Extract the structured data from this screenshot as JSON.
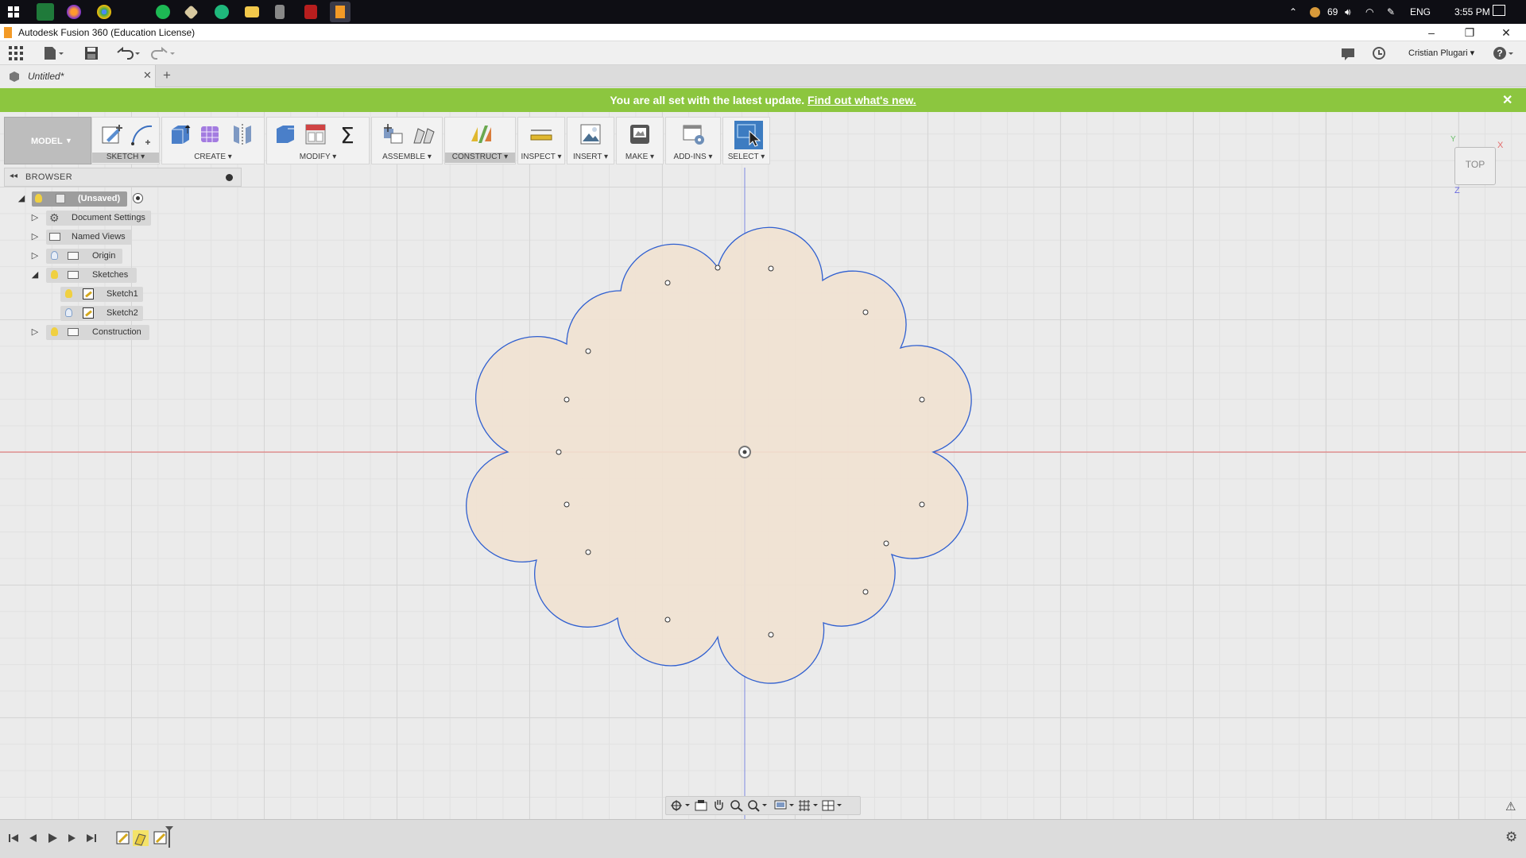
{
  "taskbar": {
    "apps": [
      "start-icon",
      "spreadsheet-icon",
      "firefox-icon",
      "chrome-icon",
      "spotify-icon",
      "git-icon",
      "arrow-app-icon",
      "file-explorer-icon",
      "calculator-icon",
      "pdf-icon",
      "fusion360-icon"
    ],
    "tray": {
      "temperature": "69",
      "language": "ENG",
      "time": "3:55 PM"
    }
  },
  "window": {
    "title": "Autodesk Fusion 360 (Education License)",
    "user": "Cristian Plugari ▾"
  },
  "document_tab": {
    "name": "Untitled*"
  },
  "banner": {
    "message": "You are all set with the latest update.",
    "link": "Find out what's new.",
    "color": "#8cc63f"
  },
  "toolbar": {
    "workspace": "MODEL",
    "groups": [
      {
        "key": "sketch",
        "label": "SKETCH ▾"
      },
      {
        "key": "create",
        "label": "CREATE ▾"
      },
      {
        "key": "modify",
        "label": "MODIFY ▾"
      },
      {
        "key": "assemble",
        "label": "ASSEMBLE ▾"
      },
      {
        "key": "construct",
        "label": "CONSTRUCT ▾"
      },
      {
        "key": "inspect",
        "label": "INSPECT ▾"
      },
      {
        "key": "insert",
        "label": "INSERT ▾"
      },
      {
        "key": "make",
        "label": "MAKE ▾"
      },
      {
        "key": "addins",
        "label": "ADD-INS ▾"
      },
      {
        "key": "select",
        "label": "SELECT ▾"
      }
    ]
  },
  "browser": {
    "header": "BROWSER",
    "root": "(Unsaved)",
    "items": [
      {
        "label": "Document Settings"
      },
      {
        "label": "Named Views"
      },
      {
        "label": "Origin"
      },
      {
        "label": "Sketches"
      },
      {
        "label": "Sketch1"
      },
      {
        "label": "Sketch2"
      },
      {
        "label": "Construction"
      }
    ]
  },
  "viewcube": {
    "face": "TOP",
    "axes": {
      "x": "X",
      "y": "Y",
      "z": "Z"
    }
  },
  "colors": {
    "sketch_fill": "#f1e2d1",
    "sketch_stroke": "#2f5fd0",
    "x_axis": "#e46b6b",
    "y_axis": "#7c8ae0",
    "accent": "#4a7fb5"
  }
}
